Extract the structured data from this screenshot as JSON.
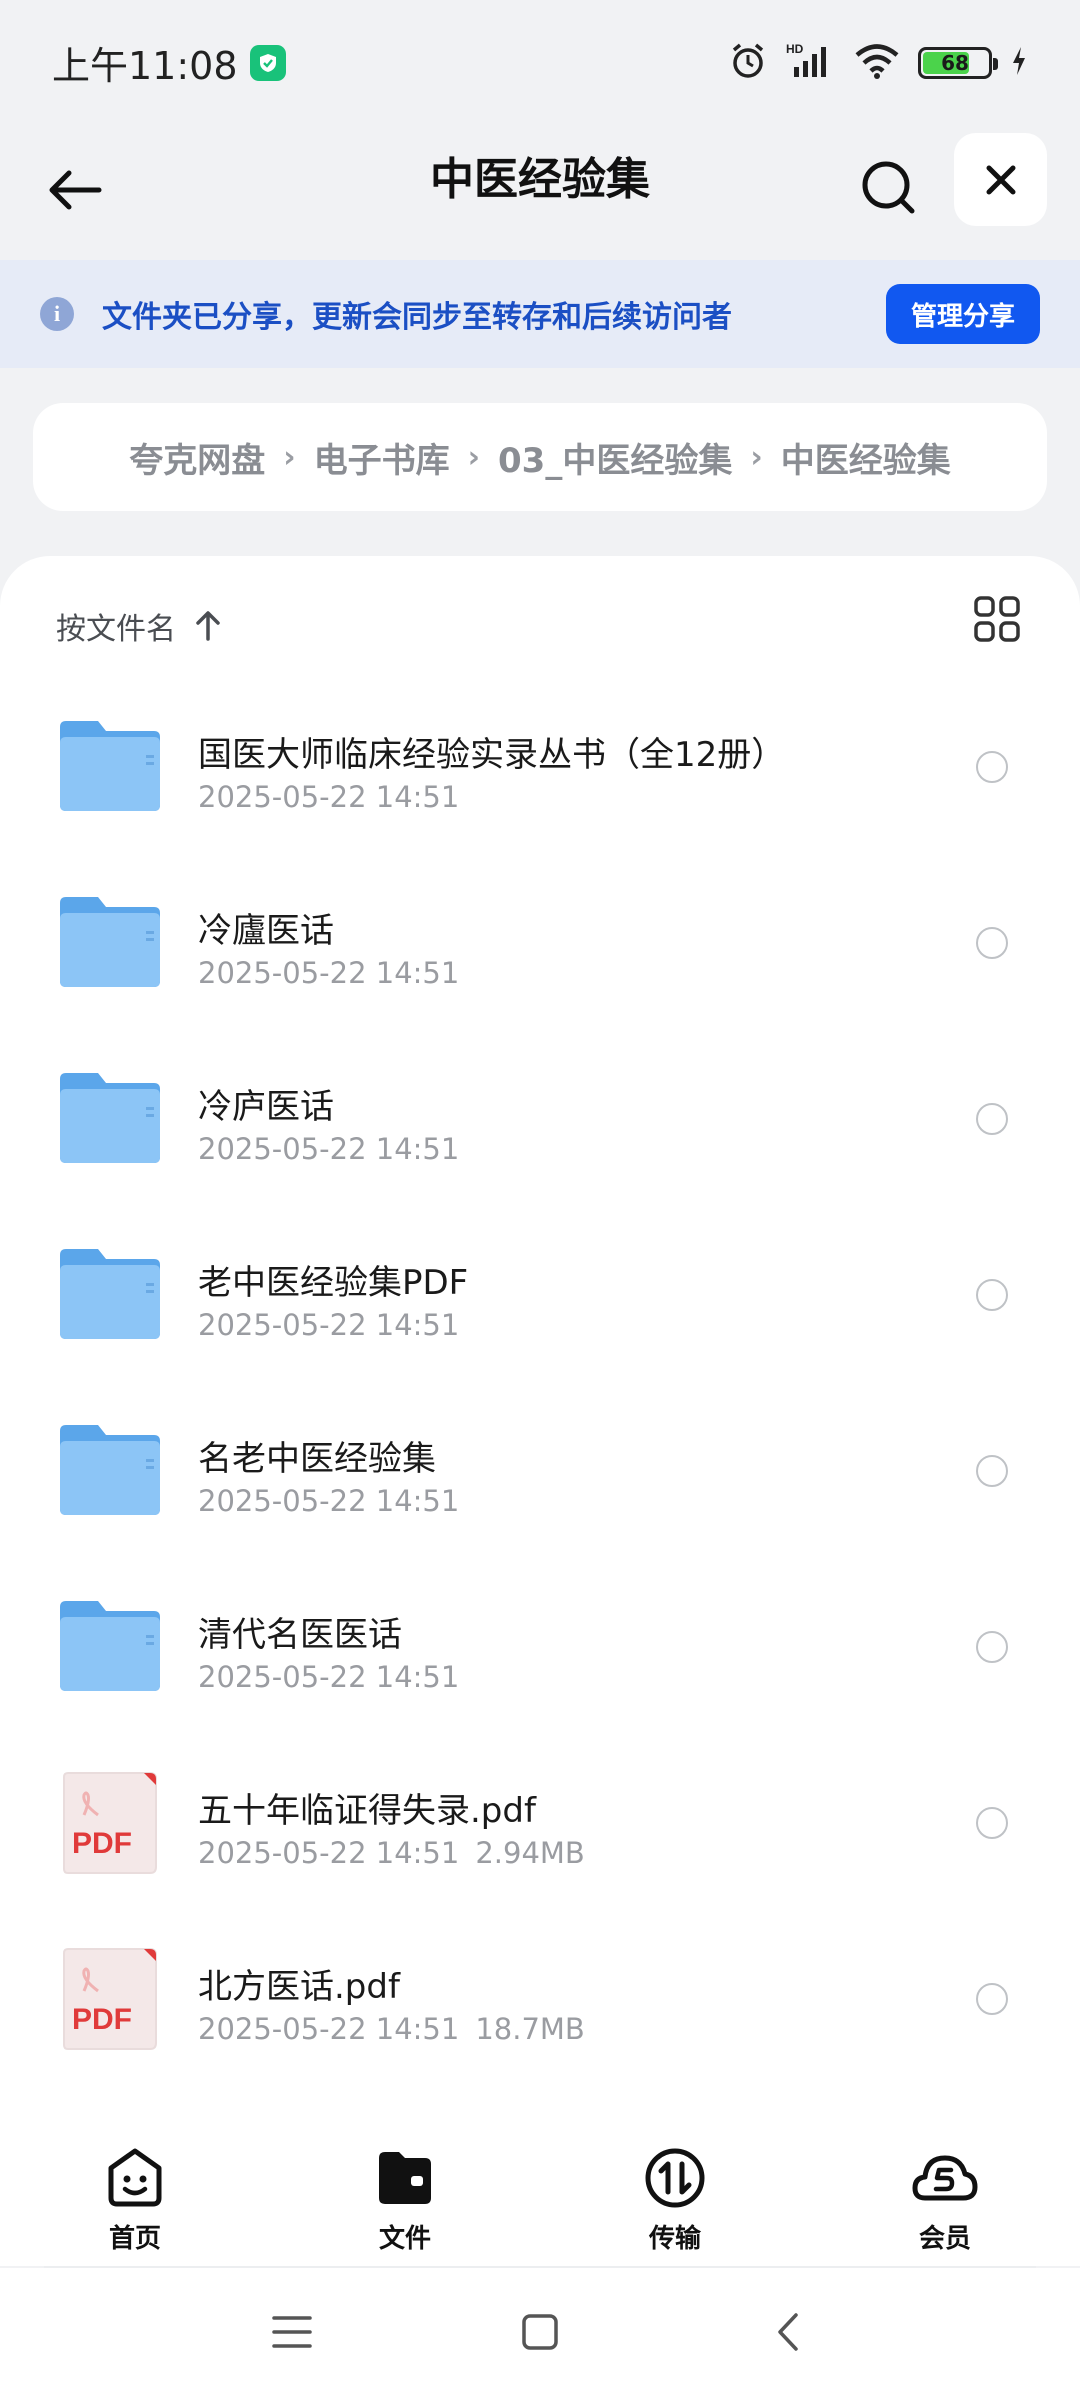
{
  "status_bar": {
    "time": "上午11:08",
    "battery": "68"
  },
  "header": {
    "title": "中医经验集"
  },
  "notice": {
    "text": "文件夹已分享，更新会同步至转存和后续访问者",
    "button": "管理分享"
  },
  "breadcrumb": [
    "夸克网盘",
    "电子书库",
    "03_中医经验集",
    "中医经验集"
  ],
  "sort": {
    "label": "按文件名"
  },
  "files": [
    {
      "name": "国医大师临床经验实录丛书（全12册）",
      "date": "2025-05-22 14:51",
      "size": "",
      "type": "folder"
    },
    {
      "name": "冷廬医话",
      "date": "2025-05-22 14:51",
      "size": "",
      "type": "folder"
    },
    {
      "name": "冷庐医话",
      "date": "2025-05-22 14:51",
      "size": "",
      "type": "folder"
    },
    {
      "name": "老中医经验集PDF",
      "date": "2025-05-22 14:51",
      "size": "",
      "type": "folder"
    },
    {
      "name": "名老中医经验集",
      "date": "2025-05-22 14:51",
      "size": "",
      "type": "folder"
    },
    {
      "name": "清代名医医话",
      "date": "2025-05-22 14:51",
      "size": "",
      "type": "folder"
    },
    {
      "name": "五十年临证得失录.pdf",
      "date": "2025-05-22 14:51",
      "size": "2.94MB",
      "type": "pdf"
    },
    {
      "name": "北方医话.pdf",
      "date": "2025-05-22 14:51",
      "size": "18.7MB",
      "type": "pdf"
    }
  ],
  "pdf_badge": "PDF",
  "bottom_nav": [
    {
      "label": "首页",
      "icon": "smile-home-icon"
    },
    {
      "label": "文件",
      "icon": "folder-files-icon"
    },
    {
      "label": "传输",
      "icon": "transfer-icon"
    },
    {
      "label": "会员",
      "icon": "cloud-vip-icon"
    }
  ],
  "colors": {
    "accent": "#1158f0",
    "folder": "#6fb3f0",
    "pdf_red": "#e03a3a"
  }
}
